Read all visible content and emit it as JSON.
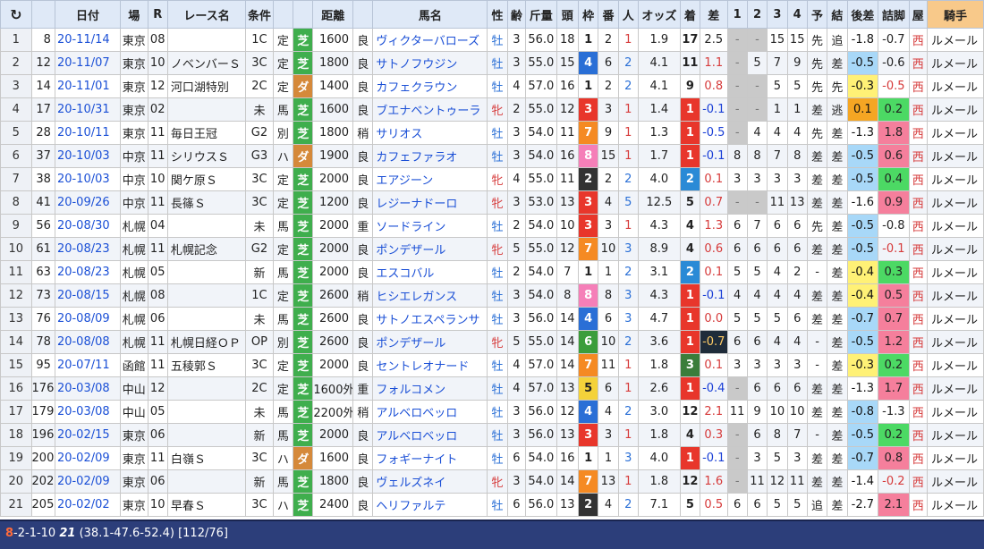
{
  "header": {
    "refresh_icon": "refresh-icon",
    "columns": [
      "",
      "日付",
      "場",
      "R",
      "レース名",
      "条件",
      "",
      "",
      "距離",
      "",
      "馬名",
      "性",
      "齢",
      "斤量",
      "頭",
      "枠",
      "番",
      "人",
      "オッズ",
      "着",
      "差",
      "1",
      "2",
      "3",
      "4",
      "予",
      "結",
      "後差",
      "詰脚",
      "屋",
      "騎手"
    ]
  },
  "colors": {
    "turf": "#3fae4d",
    "dirt": "#d5893a",
    "rank1": "#e8362b",
    "rank2": "#2a8ad6",
    "rank3": "#3b7d3b",
    "header_bg": "#dfe9f7",
    "jockey_header": "#f8c98a",
    "status_bg": "#2c3e7a"
  },
  "rows": [
    {
      "idx": "1",
      "num": "8",
      "date": "20-11/14",
      "place": "東京",
      "r": "08",
      "race": "",
      "cls": "1C",
      "rule": "定",
      "surf": "芝",
      "dist": "1600",
      "cond": "良",
      "horse": "ヴィクターバローズ",
      "sex": "牡",
      "age": "3",
      "wt": "56.0",
      "heads": "18",
      "waku": "1",
      "umaban": "2",
      "pop": "1",
      "odds": "1.9",
      "rank": "17",
      "diff": "2.5",
      "c1": "-",
      "c2": "-",
      "c3": "15",
      "c4": "15",
      "yo": "先",
      "ke": "追",
      "last3": "-1.8",
      "tsume": "-0.7",
      "yane": "西",
      "jockey": "ルメール"
    },
    {
      "idx": "2",
      "num": "12",
      "date": "20-11/07",
      "place": "東京",
      "r": "10",
      "race": "ノベンバーＳ",
      "cls": "3C",
      "rule": "定",
      "surf": "芝",
      "dist": "1800",
      "cond": "良",
      "horse": "サトノフウジン",
      "sex": "牡",
      "age": "3",
      "wt": "55.0",
      "heads": "15",
      "waku": "4",
      "umaban": "6",
      "pop": "2",
      "odds": "4.1",
      "rank": "11",
      "diff": "1.1",
      "c1": "-",
      "c2": "5",
      "c3": "7",
      "c4": "9",
      "yo": "先",
      "ke": "差",
      "last3": "-0.5",
      "tsume": "-0.6",
      "yane": "西",
      "jockey": "ルメール"
    },
    {
      "idx": "3",
      "num": "14",
      "date": "20-11/01",
      "place": "東京",
      "r": "12",
      "race": "河口湖特別",
      "cls": "2C",
      "rule": "定",
      "surf": "ダ",
      "dist": "1400",
      "cond": "良",
      "horse": "カフェクラウン",
      "sex": "牡",
      "age": "4",
      "wt": "57.0",
      "heads": "16",
      "waku": "1",
      "umaban": "2",
      "pop": "2",
      "odds": "4.1",
      "rank": "9",
      "diff": "0.8",
      "c1": "-",
      "c2": "-",
      "c3": "5",
      "c4": "5",
      "yo": "先",
      "ke": "先",
      "last3": "-0.3",
      "tsume": "-0.5",
      "yane": "西",
      "jockey": "ルメール"
    },
    {
      "idx": "4",
      "num": "17",
      "date": "20-10/31",
      "place": "東京",
      "r": "02",
      "race": "",
      "cls": "未",
      "rule": "馬",
      "surf": "芝",
      "dist": "1600",
      "cond": "良",
      "horse": "ブエナベントゥーラ",
      "sex": "牝",
      "age": "2",
      "wt": "55.0",
      "heads": "12",
      "waku": "3",
      "umaban": "3",
      "pop": "1",
      "odds": "1.4",
      "rank": "1",
      "diff": "-0.1",
      "c1": "-",
      "c2": "-",
      "c3": "1",
      "c4": "1",
      "yo": "差",
      "ke": "逃",
      "last3": "0.1",
      "tsume": "0.2",
      "yane": "西",
      "jockey": "ルメール"
    },
    {
      "idx": "5",
      "num": "28",
      "date": "20-10/11",
      "place": "東京",
      "r": "11",
      "race": "毎日王冠",
      "cls": "G2",
      "rule": "別",
      "surf": "芝",
      "dist": "1800",
      "cond": "稍",
      "horse": "サリオス",
      "sex": "牡",
      "age": "3",
      "wt": "54.0",
      "heads": "11",
      "waku": "7",
      "umaban": "9",
      "pop": "1",
      "odds": "1.3",
      "rank": "1",
      "diff": "-0.5",
      "c1": "-",
      "c2": "4",
      "c3": "4",
      "c4": "4",
      "yo": "先",
      "ke": "差",
      "last3": "-1.3",
      "tsume": "1.8",
      "yane": "西",
      "jockey": "ルメール"
    },
    {
      "idx": "6",
      "num": "37",
      "date": "20-10/03",
      "place": "中京",
      "r": "11",
      "race": "シリウスＳ",
      "cls": "G3",
      "rule": "ハ",
      "surf": "ダ",
      "dist": "1900",
      "cond": "良",
      "horse": "カフェファラオ",
      "sex": "牡",
      "age": "3",
      "wt": "54.0",
      "heads": "16",
      "waku": "8",
      "umaban": "15",
      "pop": "1",
      "odds": "1.7",
      "rank": "1",
      "diff": "-0.1",
      "c1": "8",
      "c2": "8",
      "c3": "7",
      "c4": "8",
      "yo": "差",
      "ke": "差",
      "last3": "-0.5",
      "tsume": "0.6",
      "yane": "西",
      "jockey": "ルメール"
    },
    {
      "idx": "7",
      "num": "38",
      "date": "20-10/03",
      "place": "中京",
      "r": "10",
      "race": "関ケ原Ｓ",
      "cls": "3C",
      "rule": "定",
      "surf": "芝",
      "dist": "2000",
      "cond": "良",
      "horse": "エアジーン",
      "sex": "牝",
      "age": "4",
      "wt": "55.0",
      "heads": "11",
      "waku": "2",
      "umaban": "2",
      "pop": "2",
      "odds": "4.0",
      "rank": "2",
      "diff": "0.1",
      "c1": "3",
      "c2": "3",
      "c3": "3",
      "c4": "3",
      "yo": "差",
      "ke": "差",
      "last3": "-0.5",
      "tsume": "0.4",
      "yane": "西",
      "jockey": "ルメール"
    },
    {
      "idx": "8",
      "num": "41",
      "date": "20-09/26",
      "place": "中京",
      "r": "11",
      "race": "長篠Ｓ",
      "cls": "3C",
      "rule": "定",
      "surf": "芝",
      "dist": "1200",
      "cond": "良",
      "horse": "レジーナドーロ",
      "sex": "牝",
      "age": "3",
      "wt": "53.0",
      "heads": "13",
      "waku": "3",
      "umaban": "4",
      "pop": "5",
      "odds": "12.5",
      "rank": "5",
      "diff": "0.7",
      "c1": "-",
      "c2": "-",
      "c3": "11",
      "c4": "13",
      "yo": "差",
      "ke": "差",
      "last3": "-1.6",
      "tsume": "0.9",
      "yane": "西",
      "jockey": "ルメール"
    },
    {
      "idx": "9",
      "num": "56",
      "date": "20-08/30",
      "place": "札幌",
      "r": "04",
      "race": "",
      "cls": "未",
      "rule": "馬",
      "surf": "芝",
      "dist": "2000",
      "cond": "重",
      "horse": "ソードライン",
      "sex": "牡",
      "age": "2",
      "wt": "54.0",
      "heads": "10",
      "waku": "3",
      "umaban": "3",
      "pop": "1",
      "odds": "4.3",
      "rank": "4",
      "diff": "1.3",
      "c1": "6",
      "c2": "7",
      "c3": "6",
      "c4": "6",
      "yo": "先",
      "ke": "差",
      "last3": "-0.5",
      "tsume": "-0.8",
      "yane": "西",
      "jockey": "ルメール"
    },
    {
      "idx": "10",
      "num": "61",
      "date": "20-08/23",
      "place": "札幌",
      "r": "11",
      "race": "札幌記念",
      "cls": "G2",
      "rule": "定",
      "surf": "芝",
      "dist": "2000",
      "cond": "良",
      "horse": "ポンデザール",
      "sex": "牝",
      "age": "5",
      "wt": "55.0",
      "heads": "12",
      "waku": "7",
      "umaban": "10",
      "pop": "3",
      "odds": "8.9",
      "rank": "4",
      "diff": "0.6",
      "c1": "6",
      "c2": "6",
      "c3": "6",
      "c4": "6",
      "yo": "差",
      "ke": "差",
      "last3": "-0.5",
      "tsume": "-0.1",
      "yane": "西",
      "jockey": "ルメール"
    },
    {
      "idx": "11",
      "num": "63",
      "date": "20-08/23",
      "place": "札幌",
      "r": "05",
      "race": "",
      "cls": "新",
      "rule": "馬",
      "surf": "芝",
      "dist": "2000",
      "cond": "良",
      "horse": "エスコバル",
      "sex": "牡",
      "age": "2",
      "wt": "54.0",
      "heads": "7",
      "waku": "1",
      "umaban": "1",
      "pop": "2",
      "odds": "3.1",
      "rank": "2",
      "diff": "0.1",
      "c1": "5",
      "c2": "5",
      "c3": "4",
      "c4": "2",
      "yo": "-",
      "ke": "差",
      "last3": "-0.4",
      "tsume": "0.3",
      "yane": "西",
      "jockey": "ルメール"
    },
    {
      "idx": "12",
      "num": "73",
      "date": "20-08/15",
      "place": "札幌",
      "r": "08",
      "race": "",
      "cls": "1C",
      "rule": "定",
      "surf": "芝",
      "dist": "2600",
      "cond": "稍",
      "horse": "ヒシエレガンス",
      "sex": "牡",
      "age": "3",
      "wt": "54.0",
      "heads": "8",
      "waku": "8",
      "umaban": "8",
      "pop": "3",
      "odds": "4.3",
      "rank": "1",
      "diff": "-0.1",
      "c1": "4",
      "c2": "4",
      "c3": "4",
      "c4": "4",
      "yo": "差",
      "ke": "差",
      "last3": "-0.4",
      "tsume": "0.5",
      "yane": "西",
      "jockey": "ルメール"
    },
    {
      "idx": "13",
      "num": "76",
      "date": "20-08/09",
      "place": "札幌",
      "r": "06",
      "race": "",
      "cls": "未",
      "rule": "馬",
      "surf": "芝",
      "dist": "2600",
      "cond": "良",
      "horse": "サトノエスペランサ",
      "sex": "牡",
      "age": "3",
      "wt": "56.0",
      "heads": "14",
      "waku": "4",
      "umaban": "6",
      "pop": "3",
      "odds": "4.7",
      "rank": "1",
      "diff": "0.0",
      "c1": "5",
      "c2": "5",
      "c3": "5",
      "c4": "6",
      "yo": "差",
      "ke": "差",
      "last3": "-0.7",
      "tsume": "0.7",
      "yane": "西",
      "jockey": "ルメール"
    },
    {
      "idx": "14",
      "num": "78",
      "date": "20-08/08",
      "place": "札幌",
      "r": "11",
      "race": "札幌日経ＯＰ",
      "cls": "OP",
      "rule": "別",
      "surf": "芝",
      "dist": "2600",
      "cond": "良",
      "horse": "ポンデザール",
      "sex": "牝",
      "age": "5",
      "wt": "55.0",
      "heads": "14",
      "waku": "6",
      "umaban": "10",
      "pop": "2",
      "odds": "3.6",
      "rank": "1",
      "diff": "-0.7",
      "c1": "6",
      "c2": "6",
      "c3": "4",
      "c4": "4",
      "yo": "-",
      "ke": "差",
      "last3": "-0.5",
      "tsume": "1.2",
      "yane": "西",
      "jockey": "ルメール"
    },
    {
      "idx": "15",
      "num": "95",
      "date": "20-07/11",
      "place": "函館",
      "r": "11",
      "race": "五稜郭Ｓ",
      "cls": "3C",
      "rule": "定",
      "surf": "芝",
      "dist": "2000",
      "cond": "良",
      "horse": "セントレオナード",
      "sex": "牡",
      "age": "4",
      "wt": "57.0",
      "heads": "14",
      "waku": "7",
      "umaban": "11",
      "pop": "1",
      "odds": "1.8",
      "rank": "3",
      "diff": "0.1",
      "c1": "3",
      "c2": "3",
      "c3": "3",
      "c4": "3",
      "yo": "-",
      "ke": "差",
      "last3": "-0.3",
      "tsume": "0.2",
      "yane": "西",
      "jockey": "ルメール"
    },
    {
      "idx": "16",
      "num": "176",
      "date": "20-03/08",
      "place": "中山",
      "r": "12",
      "race": "",
      "cls": "2C",
      "rule": "定",
      "surf": "芝",
      "dist": "1600外",
      "cond": "重",
      "horse": "フォルコメン",
      "sex": "牡",
      "age": "4",
      "wt": "57.0",
      "heads": "13",
      "waku": "5",
      "umaban": "6",
      "pop": "1",
      "odds": "2.6",
      "rank": "1",
      "diff": "-0.4",
      "c1": "-",
      "c2": "6",
      "c3": "6",
      "c4": "6",
      "yo": "差",
      "ke": "差",
      "last3": "-1.3",
      "tsume": "1.7",
      "yane": "西",
      "jockey": "ルメール"
    },
    {
      "idx": "17",
      "num": "179",
      "date": "20-03/08",
      "place": "中山",
      "r": "05",
      "race": "",
      "cls": "未",
      "rule": "馬",
      "surf": "芝",
      "dist": "2200外",
      "cond": "稍",
      "horse": "アルベロベッロ",
      "sex": "牡",
      "age": "3",
      "wt": "56.0",
      "heads": "12",
      "waku": "4",
      "umaban": "4",
      "pop": "2",
      "odds": "3.0",
      "rank": "12",
      "diff": "2.1",
      "c1": "11",
      "c2": "9",
      "c3": "10",
      "c4": "10",
      "yo": "差",
      "ke": "差",
      "last3": "-0.8",
      "tsume": "-1.3",
      "yane": "西",
      "jockey": "ルメール"
    },
    {
      "idx": "18",
      "num": "196",
      "date": "20-02/15",
      "place": "東京",
      "r": "06",
      "race": "",
      "cls": "新",
      "rule": "馬",
      "surf": "芝",
      "dist": "2000",
      "cond": "良",
      "horse": "アルベロベッロ",
      "sex": "牡",
      "age": "3",
      "wt": "56.0",
      "heads": "13",
      "waku": "3",
      "umaban": "3",
      "pop": "1",
      "odds": "1.8",
      "rank": "4",
      "diff": "0.3",
      "c1": "-",
      "c2": "6",
      "c3": "8",
      "c4": "7",
      "yo": "-",
      "ke": "差",
      "last3": "-0.5",
      "tsume": "0.2",
      "yane": "西",
      "jockey": "ルメール"
    },
    {
      "idx": "19",
      "num": "200",
      "date": "20-02/09",
      "place": "東京",
      "r": "11",
      "race": "白嶺Ｓ",
      "cls": "3C",
      "rule": "ハ",
      "surf": "ダ",
      "dist": "1600",
      "cond": "良",
      "horse": "フォギーナイト",
      "sex": "牡",
      "age": "6",
      "wt": "54.0",
      "heads": "16",
      "waku": "1",
      "umaban": "1",
      "pop": "3",
      "odds": "4.0",
      "rank": "1",
      "diff": "-0.1",
      "c1": "-",
      "c2": "3",
      "c3": "5",
      "c4": "3",
      "yo": "差",
      "ke": "差",
      "last3": "-0.7",
      "tsume": "0.8",
      "yane": "西",
      "jockey": "ルメール"
    },
    {
      "idx": "20",
      "num": "202",
      "date": "20-02/09",
      "place": "東京",
      "r": "06",
      "race": "",
      "cls": "新",
      "rule": "馬",
      "surf": "芝",
      "dist": "1800",
      "cond": "良",
      "horse": "ヴェルズネイ",
      "sex": "牝",
      "age": "3",
      "wt": "54.0",
      "heads": "14",
      "waku": "7",
      "umaban": "13",
      "pop": "1",
      "odds": "1.8",
      "rank": "12",
      "diff": "1.6",
      "c1": "-",
      "c2": "11",
      "c3": "12",
      "c4": "11",
      "yo": "差",
      "ke": "差",
      "last3": "-1.4",
      "tsume": "-0.2",
      "yane": "西",
      "jockey": "ルメール"
    },
    {
      "idx": "21",
      "num": "205",
      "date": "20-02/02",
      "place": "東京",
      "r": "10",
      "race": "早春Ｓ",
      "cls": "3C",
      "rule": "ハ",
      "surf": "芝",
      "dist": "2400",
      "cond": "良",
      "horse": "ヘリファルテ",
      "sex": "牡",
      "age": "6",
      "wt": "56.0",
      "heads": "13",
      "waku": "2",
      "umaban": "4",
      "pop": "2",
      "odds": "7.1",
      "rank": "5",
      "diff": "0.5",
      "c1": "6",
      "c2": "6",
      "c3": "5",
      "c4": "5",
      "yo": "追",
      "ke": "差",
      "last3": "-2.7",
      "tsume": "2.1",
      "yane": "西",
      "jockey": "ルメール"
    }
  ],
  "status": {
    "lead": "8",
    "record": "-2-1-10",
    "total": "21",
    "detail": "(38.1-47.6-52.4) [112/76]"
  }
}
